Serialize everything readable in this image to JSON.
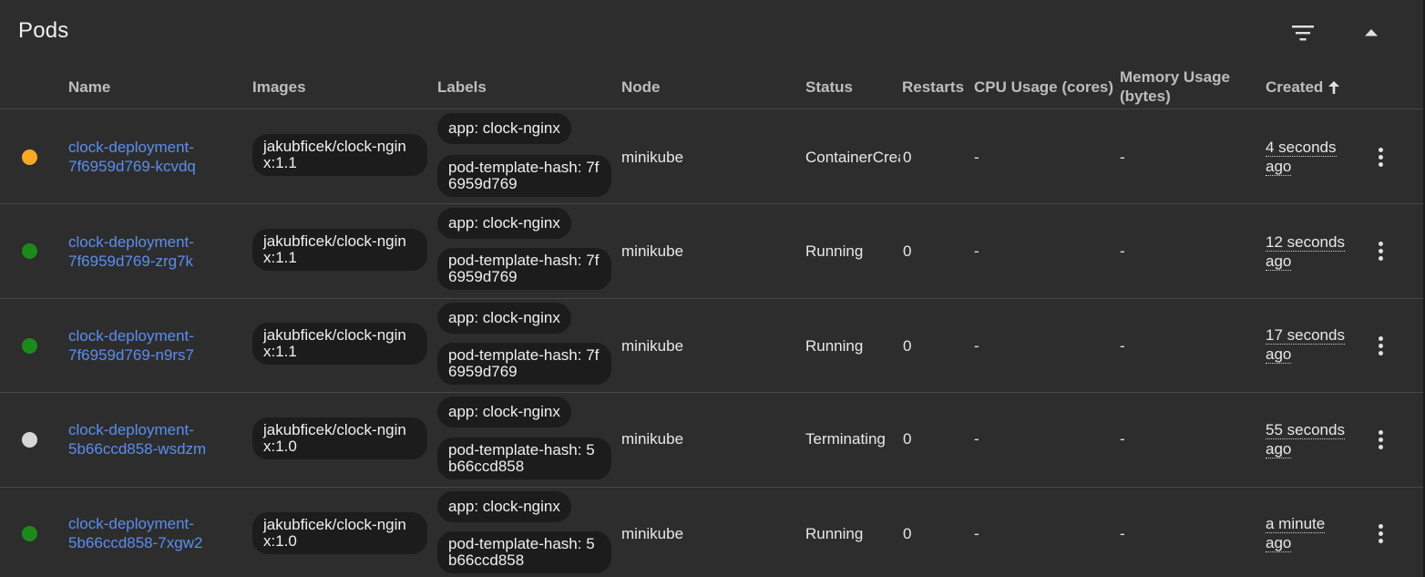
{
  "card": {
    "title": "Pods"
  },
  "header_icons": {
    "filter": "filter-list-icon",
    "collapse": "arrow-up-icon"
  },
  "columns": {
    "name": "Name",
    "images": "Images",
    "labels": "Labels",
    "node": "Node",
    "status": "Status",
    "restarts": "Restarts",
    "cpu": "CPU Usage (cores)",
    "memory_1": "Memory Usage",
    "memory_2": "(bytes)",
    "created": "Created",
    "created_sort_icon": "arrow-upward-icon"
  },
  "status_colors": {
    "pending": "#f9a825",
    "running": "#1b8a1b",
    "terminating": "#d6d6d6"
  },
  "rows": [
    {
      "status_state": "pending",
      "name_1": "clock-deployment-",
      "name_2": "7f6959d769-kcvdq",
      "image": "jakubficek/clock-nginx:1.1",
      "label_app": "app: clock-nginx",
      "label_hash": "pod-template-hash: 7f6959d769",
      "node": "minikube",
      "status": "ContainerCreating",
      "restarts": "0",
      "cpu": "-",
      "memory": "-",
      "created_1": "4 seconds",
      "created_2": "ago"
    },
    {
      "status_state": "running",
      "name_1": "clock-deployment-",
      "name_2": "7f6959d769-zrg7k",
      "image": "jakubficek/clock-nginx:1.1",
      "label_app": "app: clock-nginx",
      "label_hash": "pod-template-hash: 7f6959d769",
      "node": "minikube",
      "status": "Running",
      "restarts": "0",
      "cpu": "-",
      "memory": "-",
      "created_1": "12 seconds",
      "created_2": "ago"
    },
    {
      "status_state": "running",
      "name_1": "clock-deployment-",
      "name_2": "7f6959d769-n9rs7",
      "image": "jakubficek/clock-nginx:1.1",
      "label_app": "app: clock-nginx",
      "label_hash": "pod-template-hash: 7f6959d769",
      "node": "minikube",
      "status": "Running",
      "restarts": "0",
      "cpu": "-",
      "memory": "-",
      "created_1": "17 seconds",
      "created_2": "ago"
    },
    {
      "status_state": "terminating",
      "name_1": "clock-deployment-",
      "name_2": "5b66ccd858-wsdzm",
      "image": "jakubficek/clock-nginx:1.0",
      "label_app": "app: clock-nginx",
      "label_hash": "pod-template-hash: 5b66ccd858",
      "node": "minikube",
      "status": "Terminating",
      "restarts": "0",
      "cpu": "-",
      "memory": "-",
      "created_1": "55 seconds",
      "created_2": "ago"
    },
    {
      "status_state": "running",
      "name_1": "clock-deployment-",
      "name_2": "5b66ccd858-7xgw2",
      "image": "jakubficek/clock-nginx:1.0",
      "label_app": "app: clock-nginx",
      "label_hash": "pod-template-hash: 5b66ccd858",
      "node": "minikube",
      "status": "Running",
      "restarts": "0",
      "cpu": "-",
      "memory": "-",
      "created_1": "a minute",
      "created_2": "ago"
    }
  ],
  "row_menu_icon": "more-vert-icon"
}
